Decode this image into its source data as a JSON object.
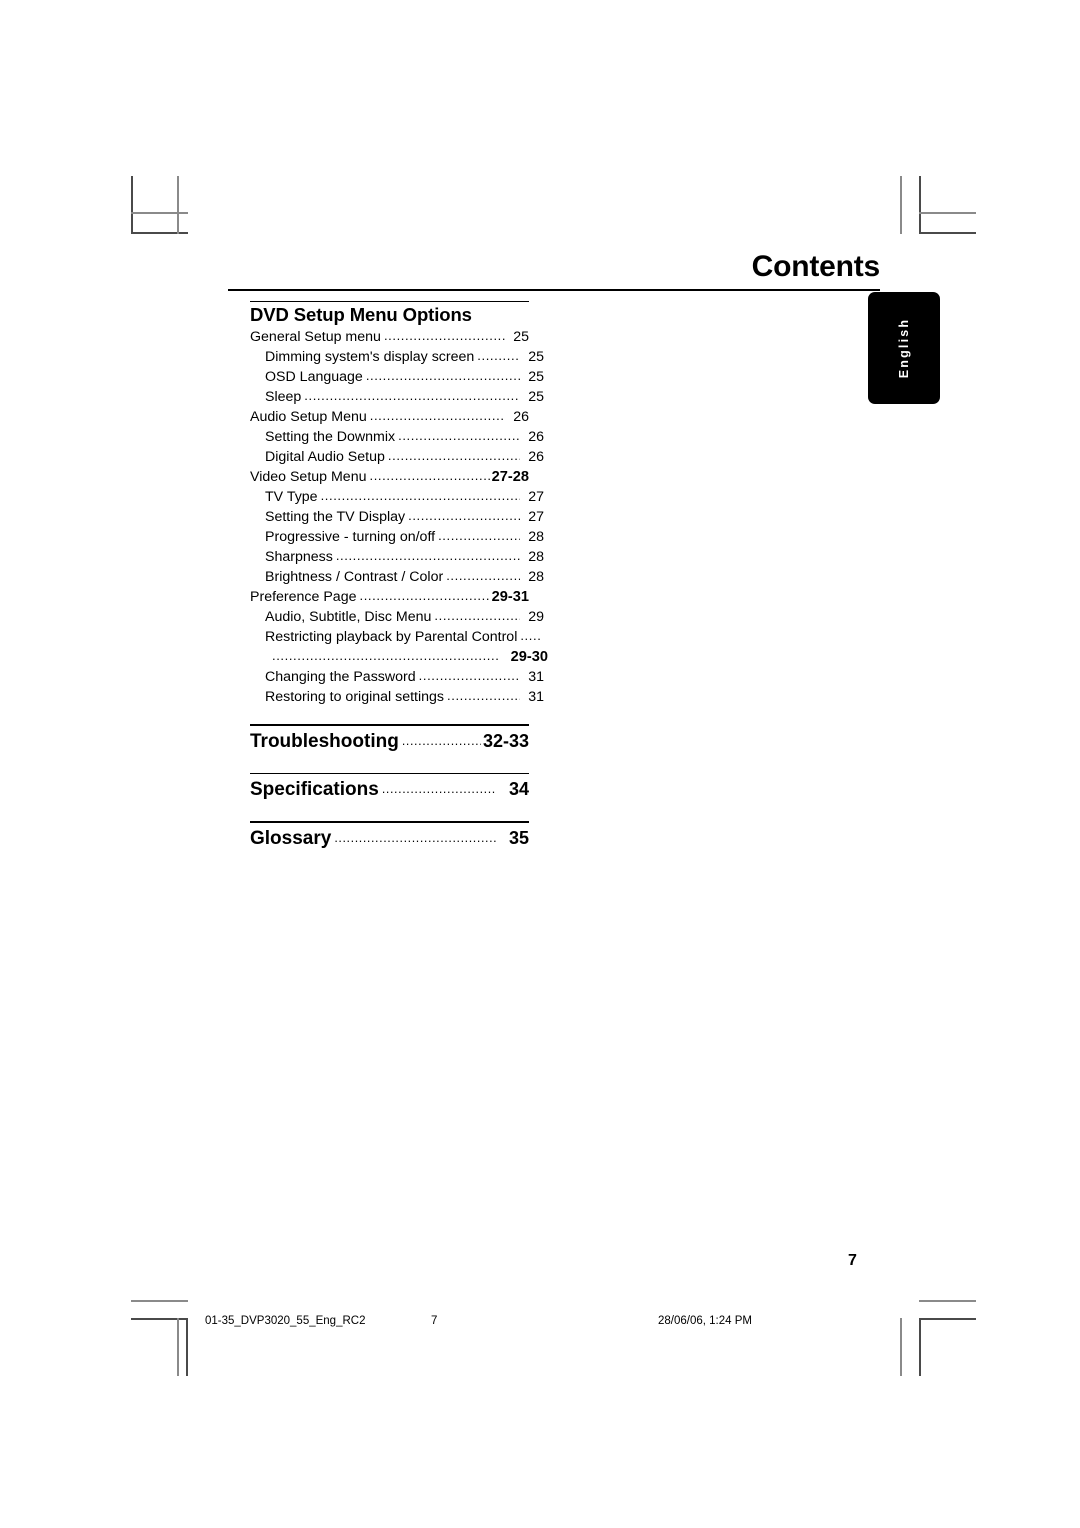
{
  "page": {
    "title": "Contents",
    "folio": "7",
    "language_tab": "English"
  },
  "toc": {
    "sections": [
      {
        "heading": "DVD Setup Menu Options",
        "entries": [
          {
            "label": "General Setup menu",
            "page": "25",
            "level": 1,
            "bold_page": false
          },
          {
            "label": "Dimming system's display screen",
            "page": "25",
            "level": 2,
            "bold_page": false
          },
          {
            "label": "OSD Language",
            "page": "25",
            "level": 2,
            "bold_page": false
          },
          {
            "label": "Sleep",
            "page": "25",
            "level": 2,
            "bold_page": false
          },
          {
            "label": "Audio Setup Menu",
            "page": "26",
            "level": 1,
            "bold_page": false
          },
          {
            "label": "Setting the Downmix",
            "page": "26",
            "level": 2,
            "bold_page": false
          },
          {
            "label": "Digital Audio Setup",
            "page": "26",
            "level": 2,
            "bold_page": false
          },
          {
            "label": "Video Setup Menu",
            "page": "27-28",
            "level": 1,
            "bold_page": true
          },
          {
            "label": "TV Type",
            "page": "27",
            "level": 2,
            "bold_page": false
          },
          {
            "label": "Setting the TV Display",
            "page": "27",
            "level": 2,
            "bold_page": false
          },
          {
            "label": "Progressive - turning on/off",
            "page": "28",
            "level": 2,
            "bold_page": false
          },
          {
            "label": "Sharpness",
            "page": "28",
            "level": 2,
            "bold_page": false
          },
          {
            "label": "Brightness / Contrast / Color",
            "page": "28",
            "level": 2,
            "bold_page": false
          },
          {
            "label": "Preference Page",
            "page": "29-31",
            "level": 1,
            "bold_page": true
          },
          {
            "label": "Audio, Subtitle, Disc Menu",
            "page": "29",
            "level": 2,
            "bold_page": false
          },
          {
            "label": "Restricting playback by Parental Control",
            "page": "",
            "level": 2,
            "bold_page": false,
            "overflow": true
          },
          {
            "label": "",
            "page": "29-30",
            "level": 2,
            "bold_page": true,
            "continuation": true
          },
          {
            "label": "Changing the Password",
            "page": "31",
            "level": 2,
            "bold_page": false
          },
          {
            "label": "Restoring to original settings",
            "page": "31",
            "level": 2,
            "bold_page": false
          }
        ]
      }
    ],
    "major_entries": [
      {
        "label": "Troubleshooting",
        "page": "32-33"
      },
      {
        "label": "Specifications",
        "page": "34"
      },
      {
        "label": "Glossary",
        "page": "35"
      }
    ]
  },
  "footer": {
    "file": "01-35_DVP3020_55_Eng_RC2",
    "page": "7",
    "date": "28/06/06, 1:24 PM"
  }
}
